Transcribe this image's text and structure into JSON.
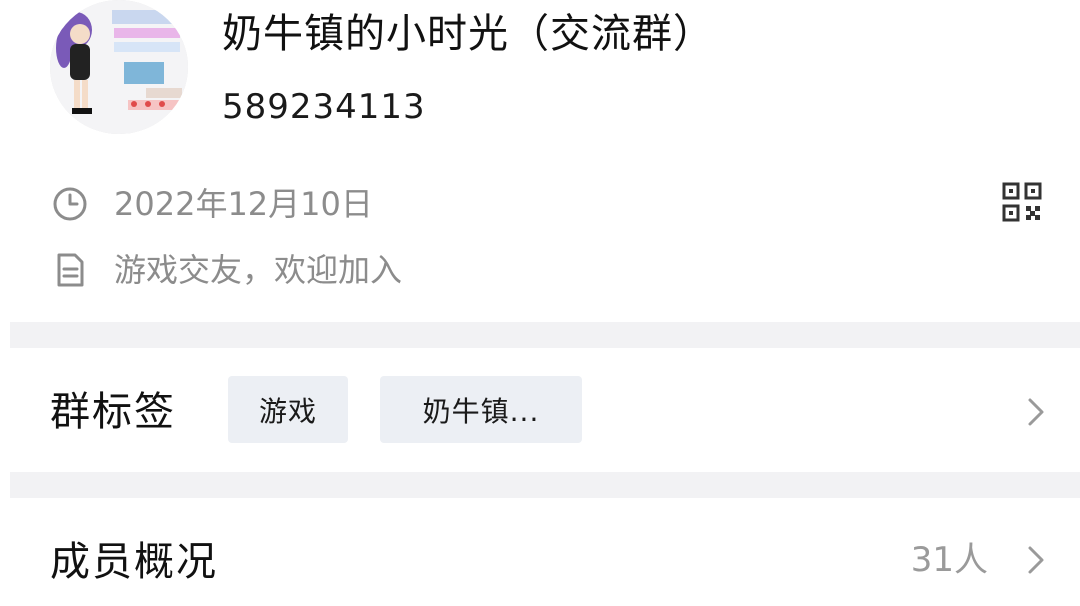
{
  "header": {
    "group_name": "奶牛镇的小时光（交流群）",
    "group_id": "589234113"
  },
  "info": {
    "created_date": "2022年12月10日",
    "description": "游戏交友，欢迎加入",
    "clock_icon": "clock-icon",
    "document_icon": "document-icon",
    "qr_icon": "qr-code-icon"
  },
  "tags_section": {
    "title": "群标签",
    "tags": [
      "游戏",
      "奶牛镇..."
    ]
  },
  "members_section": {
    "title": "成员概况",
    "count": "31人"
  },
  "colors": {
    "primary_text": "#111111",
    "secondary_text": "#8c8c8c",
    "tag_bg": "#eceff4",
    "separator": "#f2f2f4"
  }
}
